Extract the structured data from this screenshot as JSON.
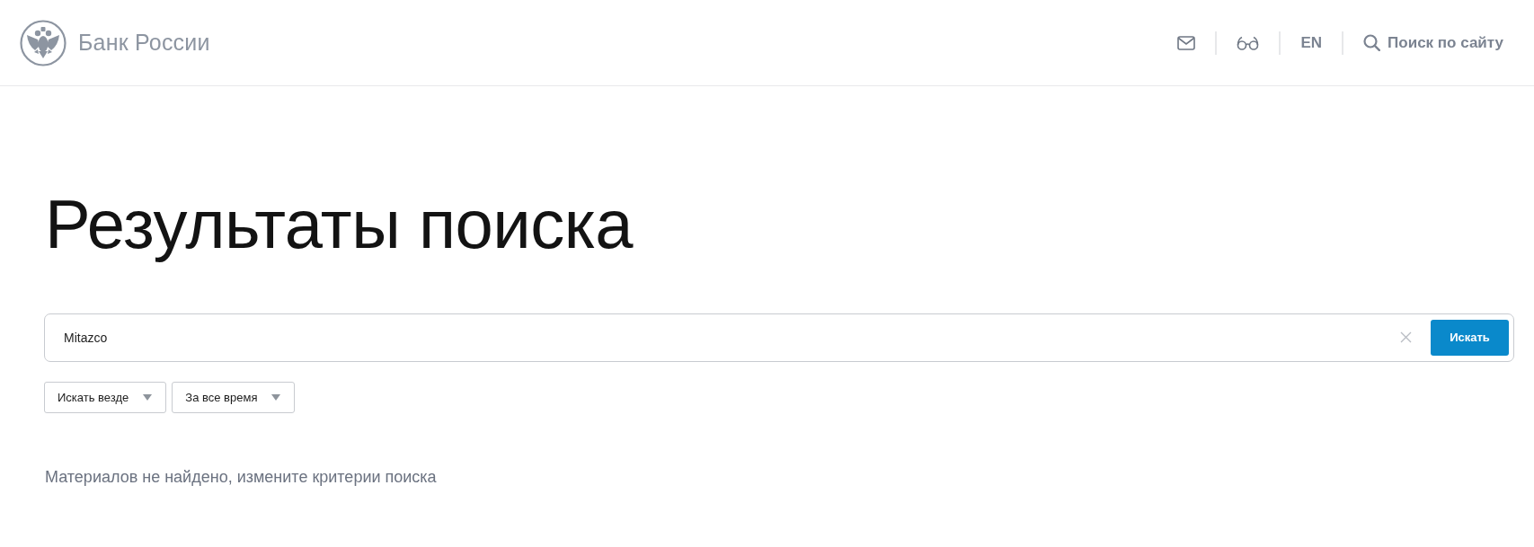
{
  "header": {
    "logo_text": "Банк России",
    "language": "EN",
    "search_link": "Поиск по сайту"
  },
  "title": "Результаты поиска",
  "search": {
    "value": "Mitazco",
    "button": "Искать"
  },
  "filters": [
    {
      "value": "Искать везде"
    },
    {
      "value": "За все время"
    }
  ],
  "message": "Материалов не найдено, измените критерии поиска"
}
